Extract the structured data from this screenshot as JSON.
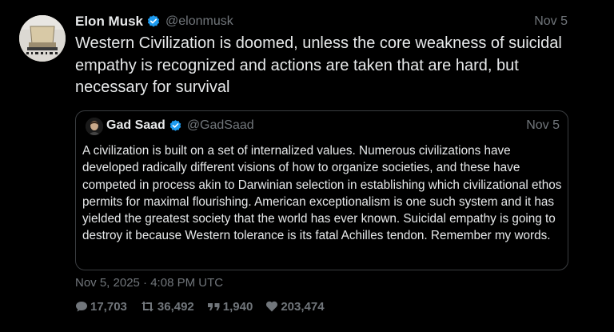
{
  "tweet": {
    "author_name": "Elon Musk",
    "handle": "@elonmusk",
    "date": "Nov 5",
    "text": "Western Civilization is doomed, unless the core weakness of suicidal empathy is recognized and actions are taken that are hard, but necessary for survival",
    "timestamp": "Nov 5, 2025 · 4:08 PM UTC",
    "stats": {
      "replies": "17,703",
      "retweets": "36,492",
      "quotes": "1,940",
      "likes": "203,474"
    }
  },
  "quote": {
    "author_name": "Gad Saad",
    "handle": "@GadSaad",
    "date": "Nov 5",
    "text": "A civilization is built on a set of internalized values.  Numerous civilizations have developed radically different visions of how to organize societies, and these have competed in process akin to Darwinian selection in establishing which civilizational ethos permits for maximal flourishing.  American exceptionalism is one such system and it has yielded the greatest society that the world has ever known.  Suicidal empathy is going to destroy it because Western tolerance is its fatal Achilles tendon. Remember my words."
  },
  "colors": {
    "background": "#000000",
    "text": "#e7e9ea",
    "muted": "#71767b",
    "verified": "#1d9bf0",
    "border": "#3a3d40"
  },
  "icons": {
    "verified": "verified-badge-icon",
    "reply": "reply-icon",
    "retweet": "retweet-icon",
    "quote": "quote-icon",
    "like": "heart-icon"
  }
}
